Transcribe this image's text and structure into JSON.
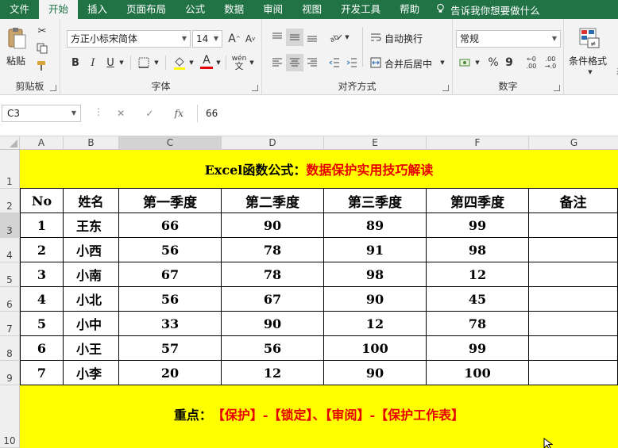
{
  "menu": {
    "tabs": [
      "文件",
      "开始",
      "插入",
      "页面布局",
      "公式",
      "数据",
      "审阅",
      "视图",
      "开发工具",
      "帮助"
    ],
    "active_index": 1,
    "tell_me": "告诉我你想要做什么"
  },
  "ribbon": {
    "clipboard": {
      "label": "剪贴板",
      "paste": "粘贴"
    },
    "font": {
      "label": "字体",
      "name": "方正小标宋简体",
      "size": "14",
      "bold": "B",
      "italic": "I",
      "underline": "U",
      "grow": "A",
      "shrink": "A",
      "font_color_letter": "A",
      "phonetic": "wén"
    },
    "alignment": {
      "label": "对齐方式",
      "wrap_text": "自动换行",
      "merge_center": "合并后居中"
    },
    "number": {
      "label": "数字",
      "format": "常规",
      "percent": "%",
      "comma": "9",
      "increase_decimal": ".00",
      "decrease_decimal": ".0"
    },
    "styles": {
      "conditional_format": "条件格式",
      "table_partial": "表"
    }
  },
  "formula_bar": {
    "name_box": "C3",
    "formula": "66",
    "fx": "fx"
  },
  "columns": [
    "A",
    "B",
    "C",
    "D",
    "E",
    "F",
    "G"
  ],
  "rows": [
    "1",
    "2",
    "3",
    "4",
    "5",
    "6",
    "7",
    "8",
    "9",
    "10"
  ],
  "sheet": {
    "title_black": "Excel函数公式：",
    "title_red": "数据保护实用技巧解读",
    "headers": [
      "No",
      "姓名",
      "第一季度",
      "第二季度",
      "第三季度",
      "第四季度",
      "备注"
    ],
    "data": [
      [
        "1",
        "王东",
        "66",
        "90",
        "89",
        "99",
        ""
      ],
      [
        "2",
        "小西",
        "56",
        "78",
        "91",
        "98",
        ""
      ],
      [
        "3",
        "小南",
        "67",
        "78",
        "98",
        "12",
        ""
      ],
      [
        "4",
        "小北",
        "56",
        "67",
        "90",
        "45",
        ""
      ],
      [
        "5",
        "小中",
        "33",
        "90",
        "12",
        "78",
        ""
      ],
      [
        "6",
        "小王",
        "57",
        "56",
        "100",
        "99",
        ""
      ],
      [
        "7",
        "小李",
        "20",
        "12",
        "90",
        "100",
        ""
      ]
    ],
    "note_black": "重点：",
    "note_red": "【保护】-【锁定】、【审阅】-【保护工作表】"
  },
  "colors": {
    "menu_green": "#217346",
    "banner_yellow": "#ffff00",
    "accent_red": "#e60000"
  }
}
